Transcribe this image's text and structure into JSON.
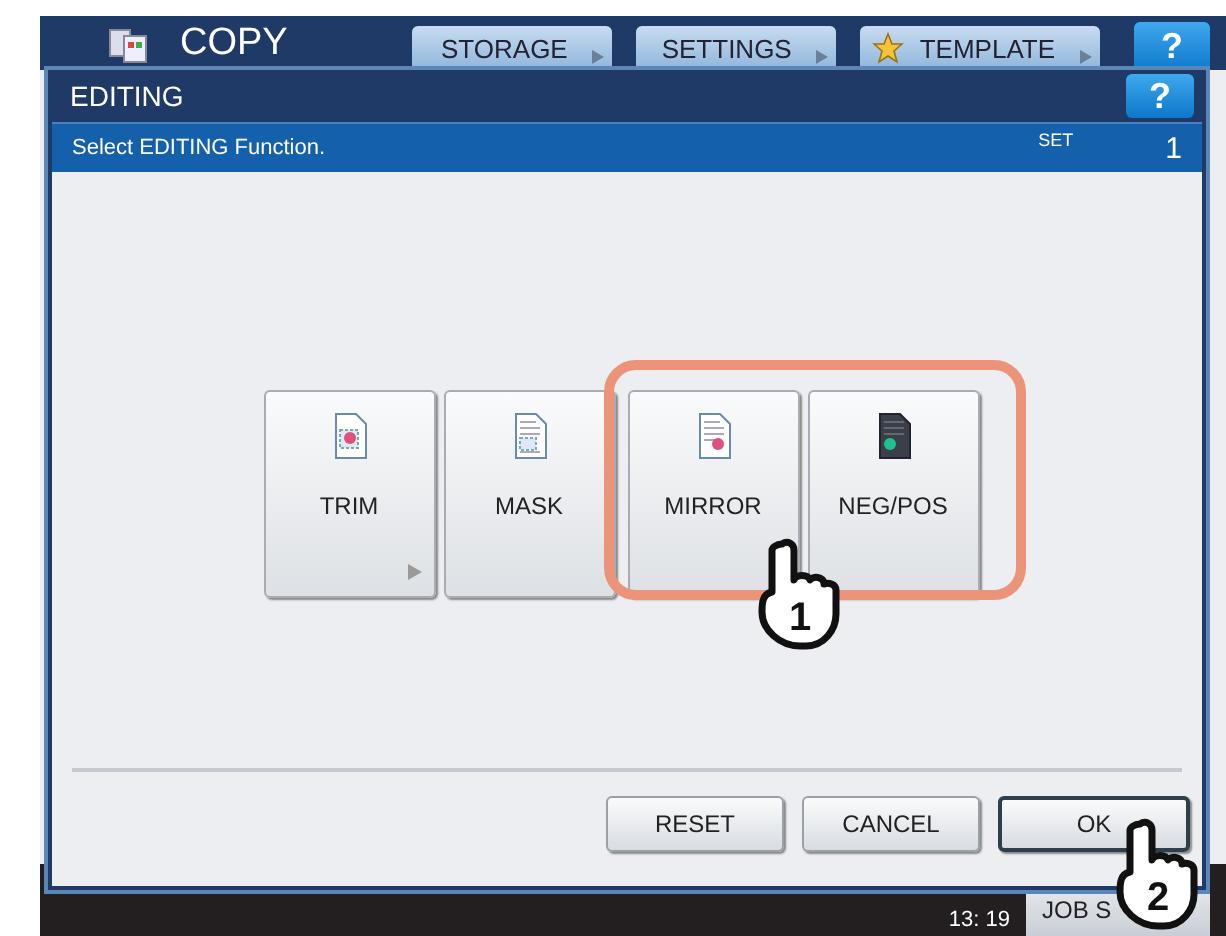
{
  "screen": {
    "title": "COPY",
    "tabs": [
      {
        "label": "STORAGE",
        "kind": "plain"
      },
      {
        "label": "SETTINGS",
        "kind": "plain"
      },
      {
        "label": "TEMPLATE",
        "kind": "starred"
      }
    ],
    "help": "?"
  },
  "dialog": {
    "title": "EDITING",
    "help": "?",
    "instruction": "Select EDITING Function.",
    "set_label": "SET",
    "set_value": "1",
    "functions": [
      {
        "label": "TRIM",
        "kind": "trim",
        "submenu": true
      },
      {
        "label": "MASK",
        "kind": "mask",
        "submenu": false
      },
      {
        "label": "MIRROR",
        "kind": "mirror",
        "submenu": false
      },
      {
        "label": "NEG/POS",
        "kind": "negpos",
        "submenu": false
      }
    ],
    "actions": [
      {
        "label": "RESET",
        "focused": false
      },
      {
        "label": "CANCEL",
        "focused": false
      },
      {
        "label": "OK",
        "focused": true
      }
    ]
  },
  "status_bar": {
    "time": "13: 19",
    "button": "JOB S"
  },
  "annotations": [
    {
      "kind": "highlight"
    },
    {
      "kind": "hand",
      "number": "1"
    },
    {
      "kind": "hand",
      "number": "2"
    }
  ]
}
